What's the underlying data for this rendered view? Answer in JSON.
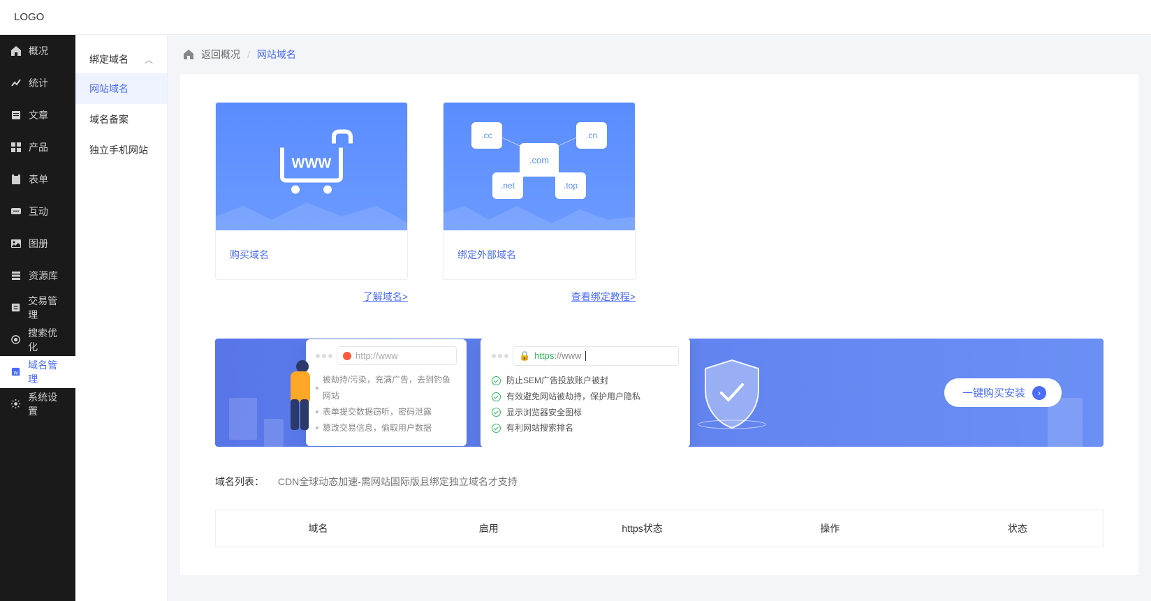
{
  "logo": "LOGO",
  "sidebar": {
    "items": [
      {
        "label": "概况",
        "icon": "home"
      },
      {
        "label": "统计",
        "icon": "stats"
      },
      {
        "label": "文章",
        "icon": "article"
      },
      {
        "label": "产品",
        "icon": "product"
      },
      {
        "label": "表单",
        "icon": "form"
      },
      {
        "label": "互动",
        "icon": "interact"
      },
      {
        "label": "图册",
        "icon": "gallery"
      },
      {
        "label": "资源库",
        "icon": "resource"
      },
      {
        "label": "交易管理",
        "icon": "trade"
      },
      {
        "label": "搜索优化",
        "icon": "seo"
      },
      {
        "label": "域名管理",
        "icon": "domain"
      },
      {
        "label": "系统设置",
        "icon": "settings"
      }
    ]
  },
  "subnav": {
    "title": "绑定域名",
    "items": [
      "网站域名",
      "域名备案",
      "独立手机网站"
    ]
  },
  "breadcrumb": {
    "back": "返回概况",
    "current": "网站域名"
  },
  "cards": [
    {
      "label": "购买域名",
      "link": "了解域名>",
      "cart_text": "WWW"
    },
    {
      "label": "绑定外部域名",
      "link": "查看绑定教程>",
      "tlds": [
        ".cc",
        ".com",
        ".cn",
        ".net",
        ".top"
      ]
    }
  ],
  "banner": {
    "bad_url": "http://www",
    "good_https": "https",
    "good_rest": "://www",
    "bad_points": [
      "被劫持/污染，充满广告，去到钓鱼网站",
      "表单提交数据窃听，密码泄露",
      "篡改交易信息，偷取用户数据"
    ],
    "good_points": [
      "防止SEM广告投放账户被封",
      "有效避免网站被劫持，保护用户隐私",
      "显示浏览器安全图标",
      "有利网站搜索排名"
    ],
    "cta": "一键购买安装"
  },
  "domain_list": {
    "label": "域名列表：",
    "desc": "CDN全球动态加速-需网站国际版且绑定独立域名才支持",
    "columns": [
      "域名",
      "启用",
      "https状态",
      "操作",
      "状态"
    ]
  }
}
